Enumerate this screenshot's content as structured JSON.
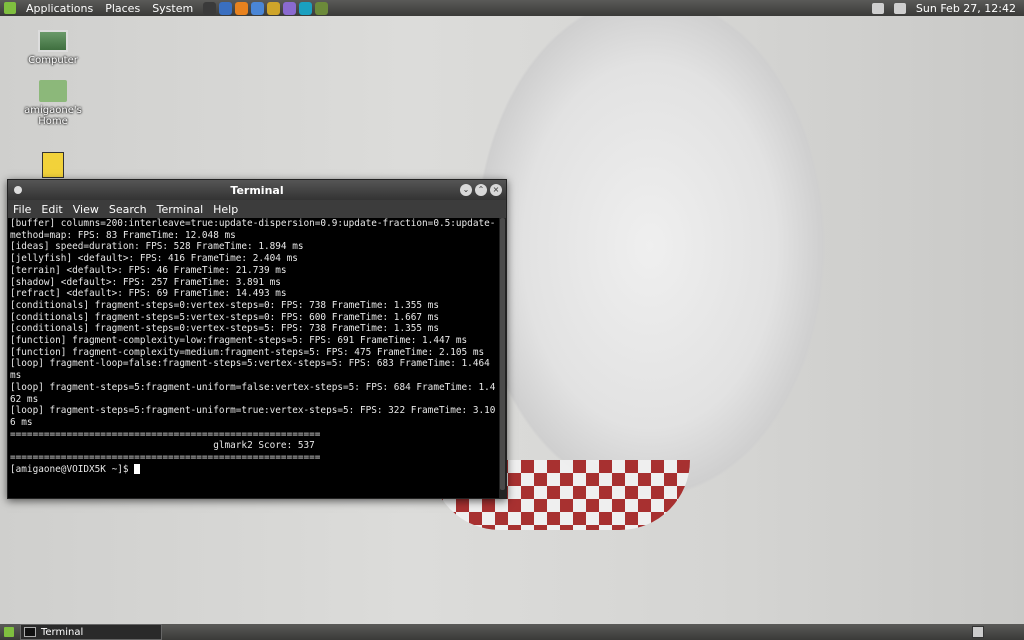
{
  "top_panel": {
    "menus": [
      "Applications",
      "Places",
      "System"
    ],
    "launchers": [
      {
        "icon": "terminal-launcher-icon",
        "color": "#3a3a3a"
      },
      {
        "icon": "globe-icon",
        "color": "#3a6fc0"
      },
      {
        "icon": "vlc-icon",
        "color": "#e8821e"
      },
      {
        "icon": "thunderbird-icon",
        "color": "#4a86d6"
      },
      {
        "icon": "chrome-icon",
        "color": "#cfa52a"
      },
      {
        "icon": "pidgin-icon",
        "color": "#8a6ad0"
      },
      {
        "icon": "network-icon",
        "color": "#1aa0c0"
      },
      {
        "icon": "image-viewer-icon",
        "color": "#6c8a3a"
      }
    ],
    "clock": "Sun Feb 27, 12:42"
  },
  "desktop_icons": [
    {
      "label": "Computer",
      "icon": "computer-icon"
    },
    {
      "label": "amigaone's Home",
      "icon": "home-folder-icon"
    },
    {
      "label": "",
      "icon": "notes-icon"
    }
  ],
  "terminal": {
    "title": "Terminal",
    "menu": [
      "File",
      "Edit",
      "View",
      "Search",
      "Terminal",
      "Help"
    ],
    "lines": [
      "[buffer] columns=200:interleave=true:update-dispersion=0.9:update-fraction=0.5:update-method=map: FPS: 83 FrameTime: 12.048 ms",
      "[ideas] speed=duration: FPS: 528 FrameTime: 1.894 ms",
      "[jellyfish] <default>: FPS: 416 FrameTime: 2.404 ms",
      "[terrain] <default>: FPS: 46 FrameTime: 21.739 ms",
      "[shadow] <default>: FPS: 257 FrameTime: 3.891 ms",
      "[refract] <default>: FPS: 69 FrameTime: 14.493 ms",
      "[conditionals] fragment-steps=0:vertex-steps=0: FPS: 738 FrameTime: 1.355 ms",
      "[conditionals] fragment-steps=5:vertex-steps=0: FPS: 600 FrameTime: 1.667 ms",
      "[conditionals] fragment-steps=0:vertex-steps=5: FPS: 738 FrameTime: 1.355 ms",
      "[function] fragment-complexity=low:fragment-steps=5: FPS: 691 FrameTime: 1.447 ms",
      "[function] fragment-complexity=medium:fragment-steps=5: FPS: 475 FrameTime: 2.105 ms",
      "[loop] fragment-loop=false:fragment-steps=5:vertex-steps=5: FPS: 683 FrameTime: 1.464 ms",
      "[loop] fragment-steps=5:fragment-uniform=false:vertex-steps=5: FPS: 684 FrameTime: 1.462 ms",
      "[loop] fragment-steps=5:fragment-uniform=true:vertex-steps=5: FPS: 322 FrameTime: 3.106 ms",
      "=======================================================",
      "                                    glmark2 Score: 537",
      "=======================================================",
      "[amigaone@VOIDX5K ~]$ "
    ]
  },
  "bottom_panel": {
    "task_label": "Terminal"
  }
}
